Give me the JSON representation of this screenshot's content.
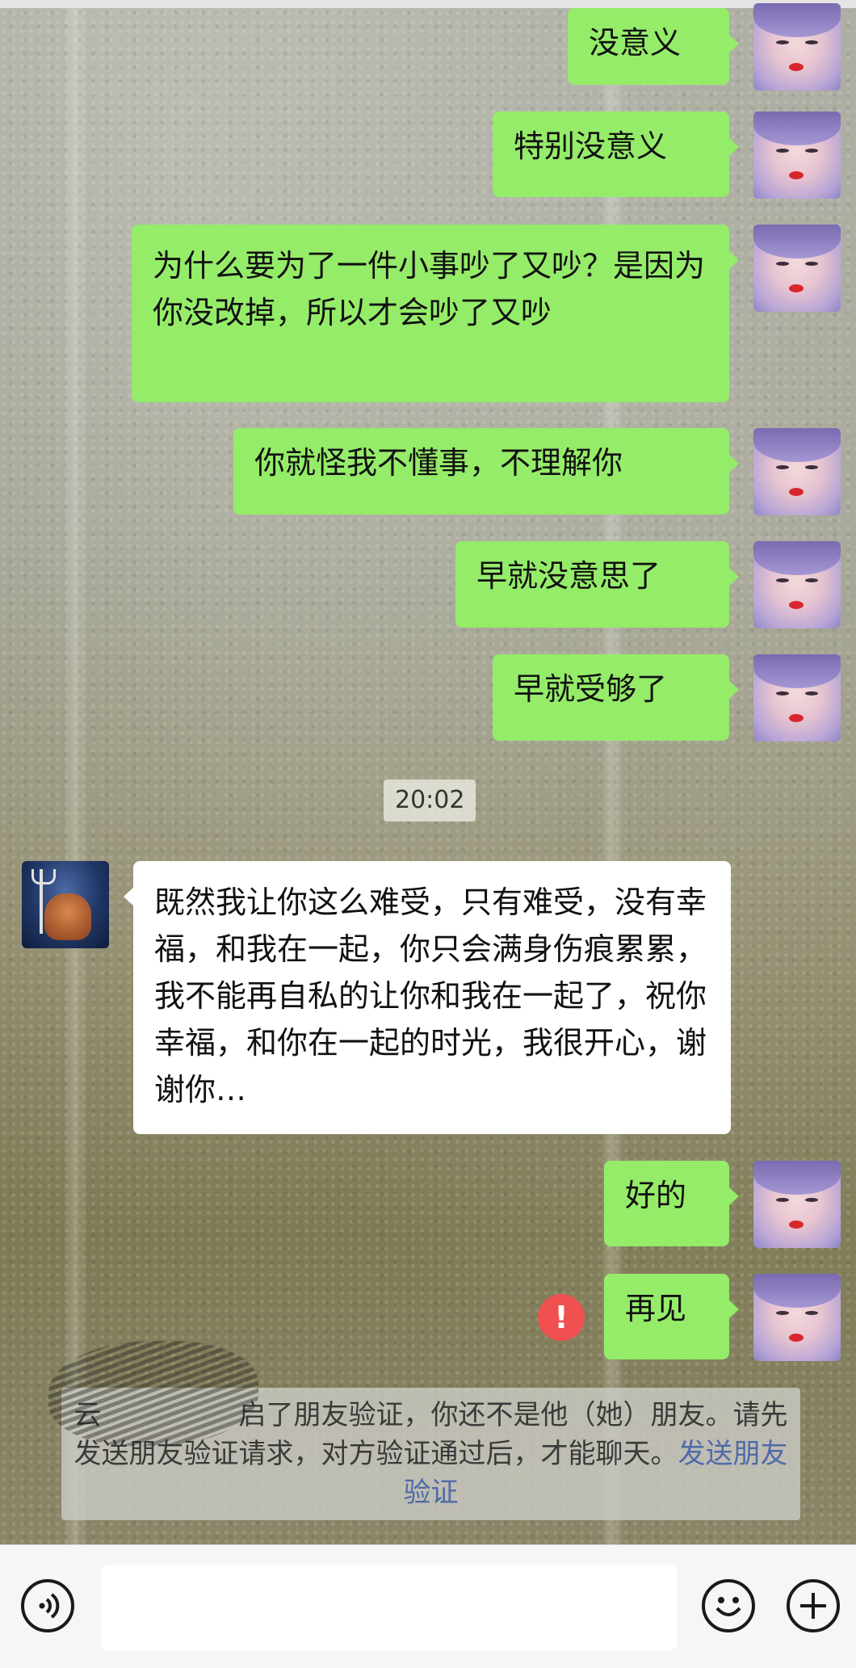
{
  "conversation": {
    "messages_before": [
      {
        "text": "没意义"
      },
      {
        "text": "特别没意义"
      },
      {
        "text": "为什么要为了一件小事吵了又吵？是因为你没改掉，所以才会吵了又吵"
      },
      {
        "text": "你就怪我不懂事，不理解你"
      },
      {
        "text": "早就没意思了"
      },
      {
        "text": "早就受够了"
      }
    ],
    "timestamp": "20:02",
    "incoming": {
      "text": "既然我让你这么难受，只有难受，没有幸福，和我在一起，你只会满身伤痕累累，我不能再自私的让你和我在一起了，祝你幸福，和你在一起的时光，我很开心，谢谢你…"
    },
    "messages_after": [
      {
        "text": "好的"
      },
      {
        "text": "再见",
        "failed": true
      }
    ],
    "error_mark": "!"
  },
  "system_notice": {
    "text": "云　　　　　启了朋友验证，你还不是他（她）朋友。请先发送朋友验证请求，对方验证通过后，才能聊天。",
    "link": "发送朋友验证"
  },
  "input_bar": {
    "voice_icon": "voice-icon",
    "emoji_icon": "emoji-icon",
    "plus_icon": "plus-icon",
    "message_value": ""
  },
  "colors": {
    "sent_bubble": "#95ec69",
    "received_bubble": "#ffffff",
    "error": "#f15050",
    "link": "#4f6aa8"
  }
}
